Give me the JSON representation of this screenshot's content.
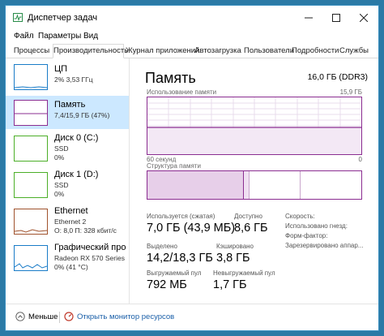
{
  "window": {
    "title": "Диспетчер задач"
  },
  "menu": [
    "Файл",
    "Параметры",
    "Вид"
  ],
  "tabs": [
    "Процессы",
    "Производительность",
    "Журнал приложений",
    "Автозагрузка",
    "Пользователи",
    "Подробности",
    "Службы"
  ],
  "sidebar": {
    "items": [
      {
        "name": "ЦП",
        "sub1": "2% 3,53 ГГц",
        "sub2": "",
        "color": "#1a7cc8"
      },
      {
        "name": "Память",
        "sub1": "7,4/15,9 ГБ (47%)",
        "sub2": "",
        "color": "#8b2d91"
      },
      {
        "name": "Диск 0 (C:)",
        "sub1": "SSD",
        "sub2": "0%",
        "color": "#4caf28"
      },
      {
        "name": "Диск 1 (D:)",
        "sub1": "SSD",
        "sub2": "0%",
        "color": "#4caf28"
      },
      {
        "name": "Ethernet",
        "sub1": "Ethernet 2",
        "sub2": "О: 8,0 П: 328 кбит/с",
        "color": "#a0522d"
      },
      {
        "name": "Графический про",
        "sub1": "Radeon RX 570 Series",
        "sub2": "0% (41 °C)",
        "color": "#1a7cc8"
      }
    ]
  },
  "main": {
    "title": "Память",
    "total": "16,0 ГБ (DDR3)",
    "usage_label": "Использование памяти",
    "usage_max": "15,9 ГБ",
    "axis_left": "60 секунд",
    "axis_right": "0",
    "structure_label": "Структура памяти",
    "stats": {
      "in_use_label": "Используется (сжатая)",
      "in_use_value": "7,0 ГБ (43,9 МБ)",
      "available_label": "Доступно",
      "available_value": "8,6 ГБ",
      "committed_label": "Выделено",
      "committed_value": "14,2/18,3 ГБ",
      "cached_label": "Кэшировано",
      "cached_value": "3,8 ГБ",
      "paged_label": "Выгружаемый пул",
      "paged_value": "792 МБ",
      "nonpaged_label": "Невыгружаемый пул",
      "nonpaged_value": "1,7 ГБ"
    },
    "info": {
      "speed": "Скорость:",
      "slots": "Использовано гнезд:",
      "form": "Форм-фактор:",
      "reserved": "Зарезервировано аппар..."
    }
  },
  "footer": {
    "fewer": "Меньше",
    "open_monitor": "Открыть монитор ресурсов"
  }
}
